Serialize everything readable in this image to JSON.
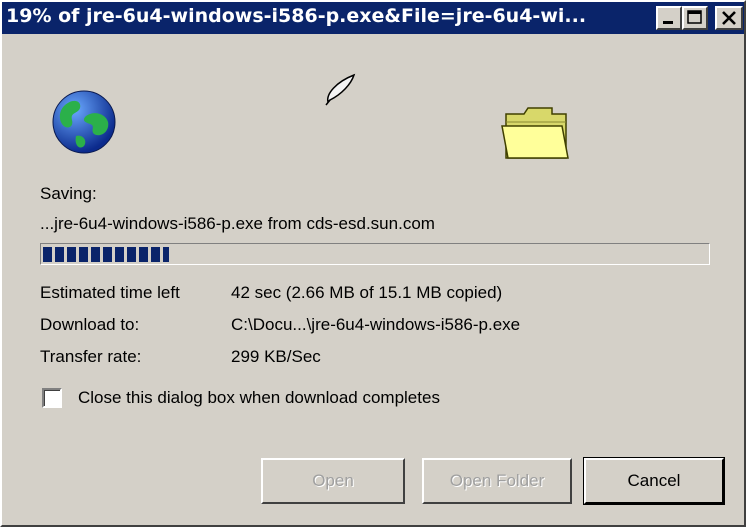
{
  "window": {
    "title": "19% of jre-6u4-windows-i586-p.exe&File=jre-6u4-wi...",
    "controls": [
      "minimize",
      "maximize",
      "close"
    ]
  },
  "icons": {
    "animation": "quill-icon",
    "source": "globe-icon",
    "destination": "folder-icon"
  },
  "status": {
    "saving_label": "Saving:",
    "saving_file": "...jre-6u4-windows-i586-p.exe from cds-esd.sun.com",
    "progress_percent": 19
  },
  "details": {
    "estimated_label": "Estimated time left",
    "estimated_value": "42 sec (2.66 MB of 15.1 MB copied)",
    "download_to_label": "Download to:",
    "download_to_value": "C:\\Docu...\\jre-6u4-windows-i586-p.exe",
    "transfer_rate_label": "Transfer rate:",
    "transfer_rate_value": "299 KB/Sec"
  },
  "options": {
    "close_on_complete_label": "Close this dialog box when download completes",
    "close_on_complete_checked": false
  },
  "buttons": {
    "open": "Open",
    "open_folder": "Open Folder",
    "cancel": "Cancel"
  },
  "colors": {
    "titlebar": "#0a246a",
    "face": "#d4d0c8",
    "progress": "#0a246a"
  }
}
